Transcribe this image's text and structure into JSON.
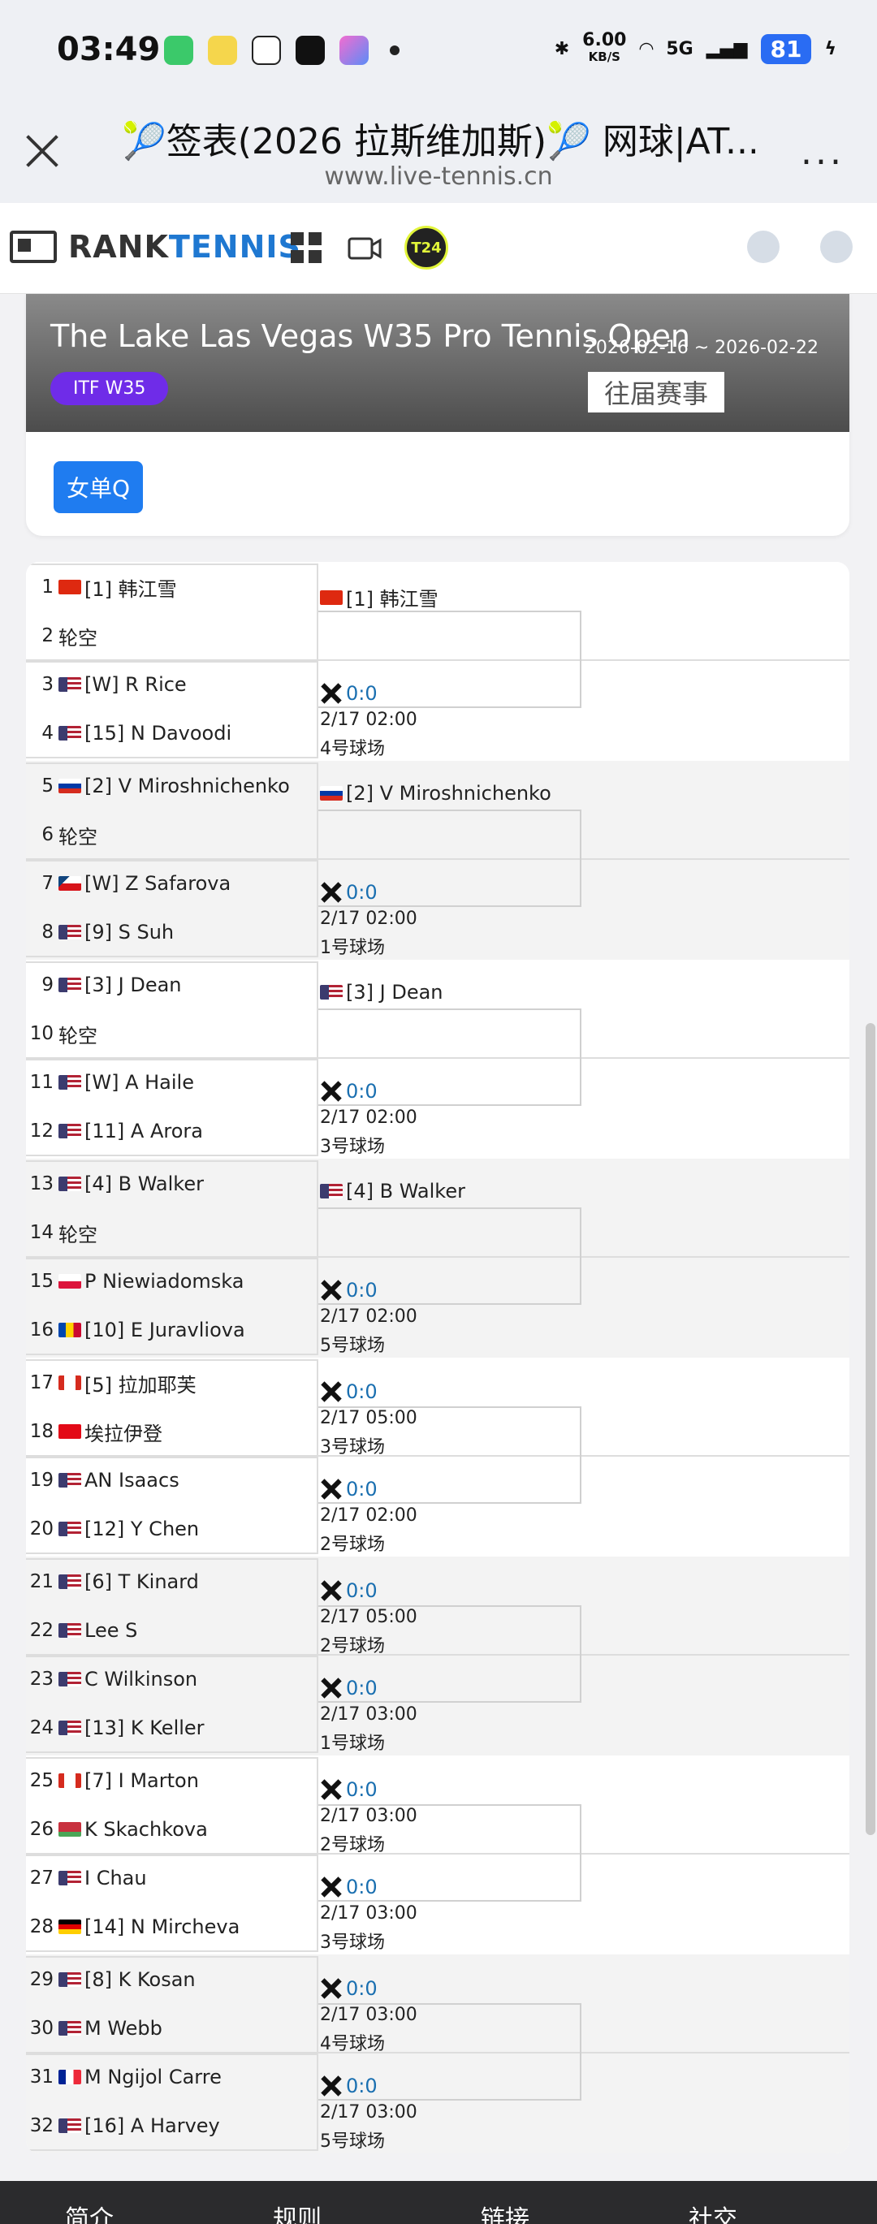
{
  "status_bar": {
    "time": "03:49",
    "net_speed": "6.00",
    "net_unit": "KB/S",
    "battery": "81",
    "signal": "5G"
  },
  "browser": {
    "title": "🎾签表(2026 拉斯维加斯)🎾 网球|AT...",
    "url": "www.live-tennis.cn"
  },
  "site": {
    "logo_left": "RANK",
    "logo_right": "TENNIS",
    "t24": "T24"
  },
  "tournament": {
    "name": "The Lake Las Vegas W35 Pro Tennis Open",
    "dates": "2026-02-16 ~ 2026-02-22",
    "level": "ITF W35",
    "past_button": "往届赛事",
    "draw_button": "女单Q"
  },
  "draw": {
    "players": [
      {
        "num": "1",
        "flag": "cn",
        "name": "[1] 韩江雪"
      },
      {
        "num": "2",
        "flag": "",
        "name": "轮空"
      },
      {
        "num": "3",
        "flag": "us",
        "name": "[W] R Rice"
      },
      {
        "num": "4",
        "flag": "us",
        "name": "[15] N Davoodi"
      },
      {
        "num": "5",
        "flag": "ru",
        "name": "[2] V Miroshnichenko"
      },
      {
        "num": "6",
        "flag": "",
        "name": "轮空"
      },
      {
        "num": "7",
        "flag": "cz",
        "name": "[W] Z Safarova"
      },
      {
        "num": "8",
        "flag": "us",
        "name": "[9] S Suh"
      },
      {
        "num": "9",
        "flag": "us",
        "name": "[3] J Dean"
      },
      {
        "num": "10",
        "flag": "",
        "name": "轮空"
      },
      {
        "num": "11",
        "flag": "us",
        "name": "[W] A Haile"
      },
      {
        "num": "12",
        "flag": "us",
        "name": "[11] A Arora"
      },
      {
        "num": "13",
        "flag": "us",
        "name": "[4] B Walker"
      },
      {
        "num": "14",
        "flag": "",
        "name": "轮空"
      },
      {
        "num": "15",
        "flag": "pl",
        "name": "P Niewiadomska"
      },
      {
        "num": "16",
        "flag": "md",
        "name": "[10] E Juravliova"
      },
      {
        "num": "17",
        "flag": "ca",
        "name": "[5] 拉加耶芙"
      },
      {
        "num": "18",
        "flag": "tr",
        "name": "埃拉伊登"
      },
      {
        "num": "19",
        "flag": "us",
        "name": "AN Isaacs"
      },
      {
        "num": "20",
        "flag": "us",
        "name": "[12] Y Chen"
      },
      {
        "num": "21",
        "flag": "us",
        "name": "[6] T Kinard"
      },
      {
        "num": "22",
        "flag": "us",
        "name": "Lee S"
      },
      {
        "num": "23",
        "flag": "us",
        "name": "C Wilkinson"
      },
      {
        "num": "24",
        "flag": "us",
        "name": "[13] K Keller"
      },
      {
        "num": "25",
        "flag": "ca",
        "name": "[7] I Marton"
      },
      {
        "num": "26",
        "flag": "by",
        "name": "K Skachkova"
      },
      {
        "num": "27",
        "flag": "us",
        "name": "I Chau"
      },
      {
        "num": "28",
        "flag": "de",
        "name": "[14] N Mircheva"
      },
      {
        "num": "29",
        "flag": "us",
        "name": "[8] K Kosan"
      },
      {
        "num": "30",
        "flag": "us",
        "name": "M Webb"
      },
      {
        "num": "31",
        "flag": "fr",
        "name": "M Ngijol Carre"
      },
      {
        "num": "32",
        "flag": "us",
        "name": "[16] A Harvey"
      }
    ],
    "matches": [
      {
        "advance_flag": "cn",
        "advance": "[1] 韩江雪",
        "score": "0:0",
        "time": "2/17 02:00",
        "court": "4号球场"
      },
      {
        "advance_flag": "ru",
        "advance": "[2] V Miroshnichenko",
        "score": "0:0",
        "time": "2/17 02:00",
        "court": "1号球场"
      },
      {
        "advance_flag": "us",
        "advance": "[3] J Dean",
        "score": "0:0",
        "time": "2/17 02:00",
        "court": "3号球场"
      },
      {
        "advance_flag": "us",
        "advance": "[4] B Walker",
        "score": "0:0",
        "time": "2/17 02:00",
        "court": "5号球场"
      },
      {
        "score_a": "0:0",
        "time_a": "2/17 05:00",
        "court_a": "3号球场",
        "score_b": "0:0",
        "time_b": "2/17 02:00",
        "court_b": "2号球场"
      },
      {
        "score_a": "0:0",
        "time_a": "2/17 05:00",
        "court_a": "2号球场",
        "score_b": "0:0",
        "time_b": "2/17 03:00",
        "court_b": "1号球场"
      },
      {
        "score_a": "0:0",
        "time_a": "2/17 03:00",
        "court_a": "2号球场",
        "score_b": "0:0",
        "time_b": "2/17 03:00",
        "court_b": "3号球场"
      },
      {
        "score_a": "0:0",
        "time_a": "2/17 03:00",
        "court_a": "4号球场",
        "score_b": "0:0",
        "time_b": "2/17 03:00",
        "court_b": "5号球场"
      }
    ]
  },
  "bottom_nav": [
    "简介",
    "规则",
    "链接",
    "社交"
  ],
  "colors": {
    "accent": "#1f78d1",
    "level_badge": "#6f2ce8",
    "draw_button": "#1f7cf0",
    "score": "#1a6fb0"
  }
}
